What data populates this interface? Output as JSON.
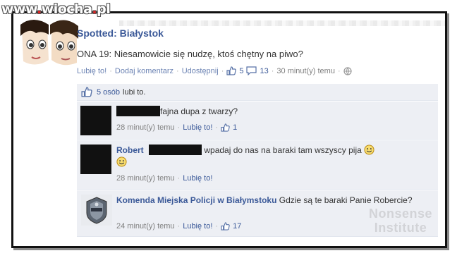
{
  "watermark": {
    "prefix": "www",
    "dot": ".",
    "site": "wiocha",
    "dot2": ".",
    "tld": "pl"
  },
  "post": {
    "title": "Spotted: Białystok",
    "text": "ONA 19: Niesamowicie się nudzę, ktoś chętny na piwo?",
    "like_label": "Lubię to!",
    "comment_label": "Dodaj komentarz",
    "share_label": "Udostępnij",
    "like_count": "5",
    "comment_count": "13",
    "time": "30 minut(y) temu"
  },
  "likes_summary": {
    "link": "5 osób",
    "suffix": "lubi to."
  },
  "comments": [
    {
      "author": "",
      "text": "fajna dupa z twarzy?",
      "time": "28 minut(y) temu",
      "like_label": "Lubię to!",
      "like_count": "1"
    },
    {
      "author": "Robert",
      "text": "wpadaj do nas na baraki tam wszyscy pija",
      "time": "28 minut(y) temu",
      "like_label": "Lubię to!"
    },
    {
      "author": "Komenda Miejska Policji w Białymstoku",
      "text": "Gdzie są te baraki Panie Robercie?",
      "time": "24 minut(y) temu",
      "like_label": "Lubię to!",
      "like_count": "17"
    }
  ],
  "corner_watermark": {
    "line1": "Nonsense",
    "line2": "Institute"
  },
  "colors": {
    "fb_blue": "#3b5998",
    "link_light": "#6d84b4",
    "comment_bg": "#edeff4"
  }
}
